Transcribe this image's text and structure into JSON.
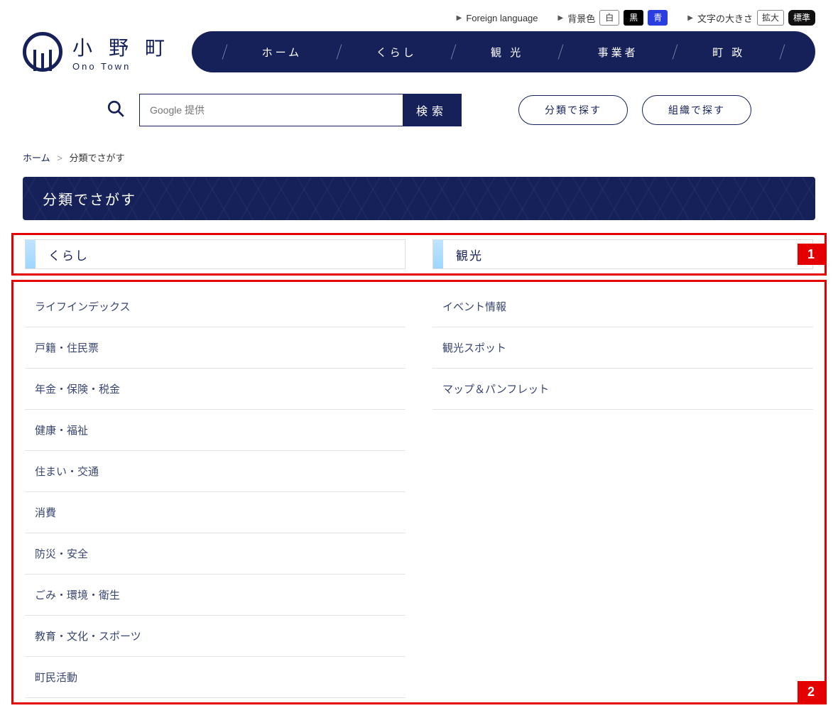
{
  "util": {
    "foreign": "Foreign language",
    "bgcolor_label": "背景色",
    "bgcolor_white": "白",
    "bgcolor_black": "黒",
    "bgcolor_blue": "青",
    "fontsize_label": "文字の大きさ",
    "fontsize_large": "拡大",
    "fontsize_normal": "標準"
  },
  "logo": {
    "jp": "小 野 町",
    "en": "Ono Town"
  },
  "nav": {
    "home": "ホーム",
    "kurashi": "くらし",
    "kanko": "観 光",
    "jigyosha": "事業者",
    "chosei": "町 政"
  },
  "search": {
    "placeholder": "Google 提供",
    "button": "検索",
    "by_category": "分類で探す",
    "by_org": "組織で探す"
  },
  "breadcrumb": {
    "home": "ホーム",
    "current": "分類でさがす"
  },
  "page_title": "分類でさがす",
  "categories": {
    "left": {
      "title": "くらし",
      "items": [
        "ライフインデックス",
        "戸籍・住民票",
        "年金・保険・税金",
        "健康・福祉",
        "住まい・交通",
        "消費",
        "防災・安全",
        "ごみ・環境・衛生",
        "教育・文化・スポーツ",
        "町民活動"
      ]
    },
    "right": {
      "title": "観光",
      "items": [
        "イベント情報",
        "観光スポット",
        "マップ＆パンフレット"
      ]
    }
  },
  "annot": {
    "box1": "1",
    "box2": "2"
  }
}
